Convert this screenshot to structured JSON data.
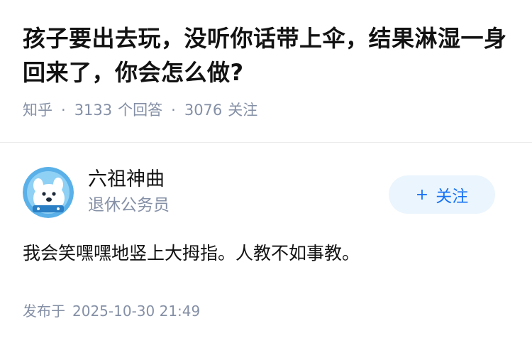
{
  "question": {
    "title": "孩子要出去玩，没听你话带上伞，结果淋湿一身回来了，你会怎么做?",
    "source": "知乎",
    "separator": "·",
    "answer_count": "3133",
    "answer_label": "个回答",
    "follower_count": "3076",
    "follower_label": "关注"
  },
  "answer": {
    "author": {
      "name": "六祖神曲",
      "title": "退休公务员",
      "avatar_icon": "snow-dog-avatar-icon"
    },
    "follow_button": {
      "plus": "+",
      "label": "关注"
    },
    "content": "我会笑嘿嘿地竖上大拇指。人教不如事教。",
    "published_label": "发布于",
    "published_time": "2025-10-30 21:49"
  },
  "colors": {
    "text_primary": "#121212",
    "text_secondary": "#8590a6",
    "brand_blue": "#1772f6",
    "follow_bg": "#ebf5fd",
    "divider": "#ebebeb"
  }
}
